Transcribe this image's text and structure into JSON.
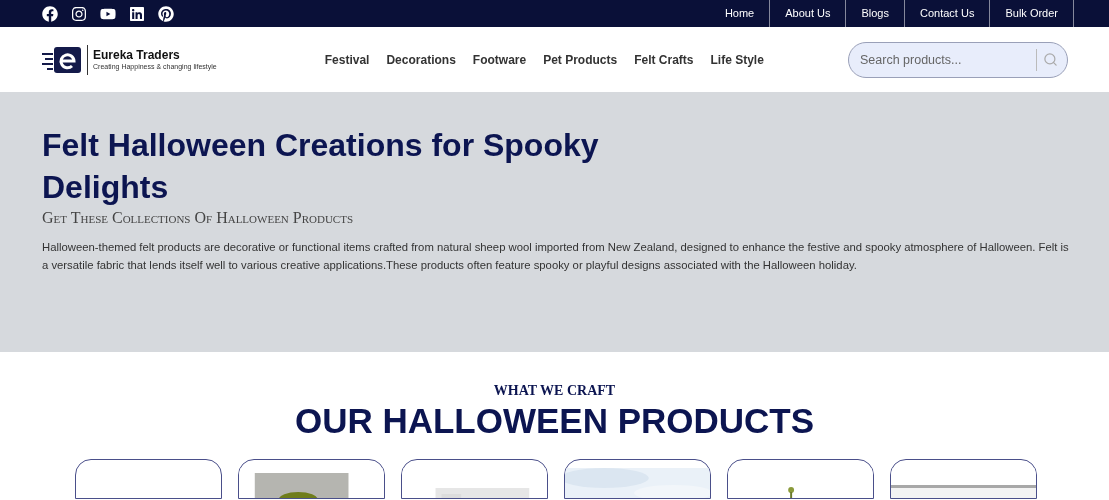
{
  "top_links": [
    "Home",
    "About Us",
    "Blogs",
    "Contact Us",
    "Bulk Order"
  ],
  "brand": {
    "name": "Eureka Traders",
    "tagline": "Creating Happiness & changing lifestyle"
  },
  "nav": [
    "Festival",
    "Decorations",
    "Footware",
    "Pet Products",
    "Felt Crafts",
    "Life Style"
  ],
  "search": {
    "placeholder": "Search products..."
  },
  "hero": {
    "title": "Felt Halloween Creations for Spooky Delights",
    "subtitle": "Get These Collections Of Halloween Products",
    "body": "Halloween-themed felt products are decorative or functional items crafted from natural sheep wool imported from New Zealand, designed to enhance the festive and spooky atmosphere of Halloween. Felt is a versatile fabric that lends itself well to various creative applications.These products often feature spooky or playful designs associated with the Halloween holiday."
  },
  "section": {
    "eyebrow": "WHAT WE CRAFT",
    "title": "OUR HALLOWEEN PRODUCTS"
  },
  "products": [
    {
      "kind": "empty"
    },
    {
      "kind": "picture"
    },
    {
      "kind": "picture"
    },
    {
      "kind": "picture"
    },
    {
      "kind": "picture"
    },
    {
      "kind": "picture"
    }
  ]
}
